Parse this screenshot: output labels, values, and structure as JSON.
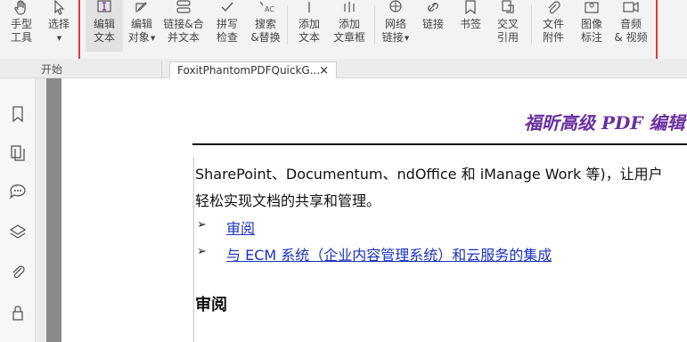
{
  "ribbon": {
    "hand_tool": "手型\n工具",
    "select": "选择",
    "edit_text": "编辑\n文本",
    "edit_object": "编辑\n对象",
    "link_merge": "链接&合\n并文本",
    "spell_check": "拼写\n检查",
    "search_replace": "搜索\n&替换",
    "add_text": "添加\n文本",
    "add_textbox": "添加\n文章框",
    "web_link": "网络\n链接",
    "link": "链接",
    "bookmark": "书签",
    "cross_ref": "交叉\n引用",
    "file_attachment": "文件\n附件",
    "image_annotation": "图像\n标注",
    "audio_video": "音频\n& 视频"
  },
  "tabs": {
    "home": "开始",
    "document": "FoxitPhantomPDFQuickG...",
    "close": "×"
  },
  "document": {
    "title": "福昕高级 PDF 编辑",
    "para_line1": "SharePoint、Documentum、ndOffice 和 iManage Work 等)，让用户",
    "para_line2": "轻松实现文档的共享和管理。",
    "bullet_symbol": "➢",
    "link1": "审阅",
    "link2": "与 ECM 系统（企业内容管理系统）和云服务的集成",
    "heading": "审阅"
  },
  "colors": {
    "highlight_box": "#e53935",
    "title": "#6a2fa0",
    "link": "#1a33b8"
  }
}
